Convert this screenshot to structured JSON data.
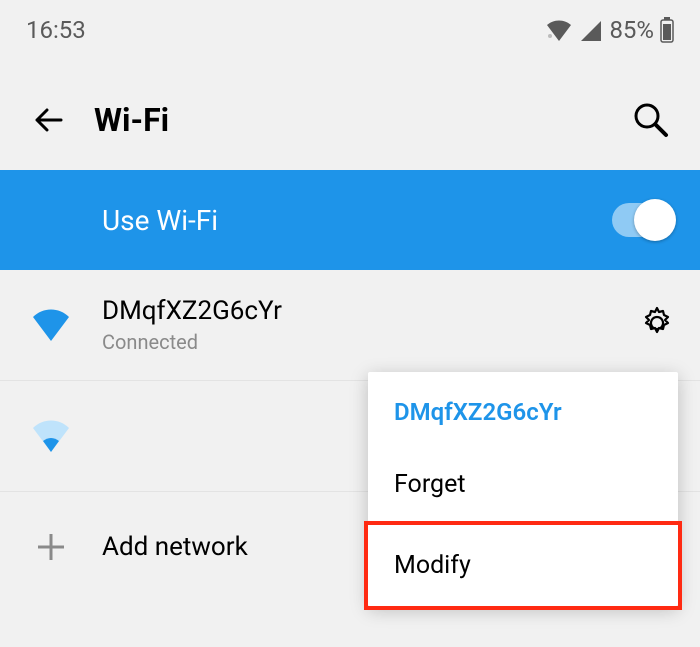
{
  "status_bar": {
    "time": "16:53",
    "battery_pct": "85%"
  },
  "header": {
    "title": "Wi-Fi"
  },
  "toggle": {
    "label": "Use Wi-Fi",
    "on": true
  },
  "networks": [
    {
      "name": "DMqfXZ2G6cYr",
      "status": "Connected",
      "signal": "full"
    },
    {
      "name": "",
      "status": "",
      "signal": "weak"
    }
  ],
  "add_network_label": "Add network",
  "popup": {
    "network_name": "DMqfXZ2G6cYr",
    "items": [
      {
        "label": "Forget",
        "highlighted": false
      },
      {
        "label": "Modify",
        "highlighted": true
      }
    ]
  }
}
